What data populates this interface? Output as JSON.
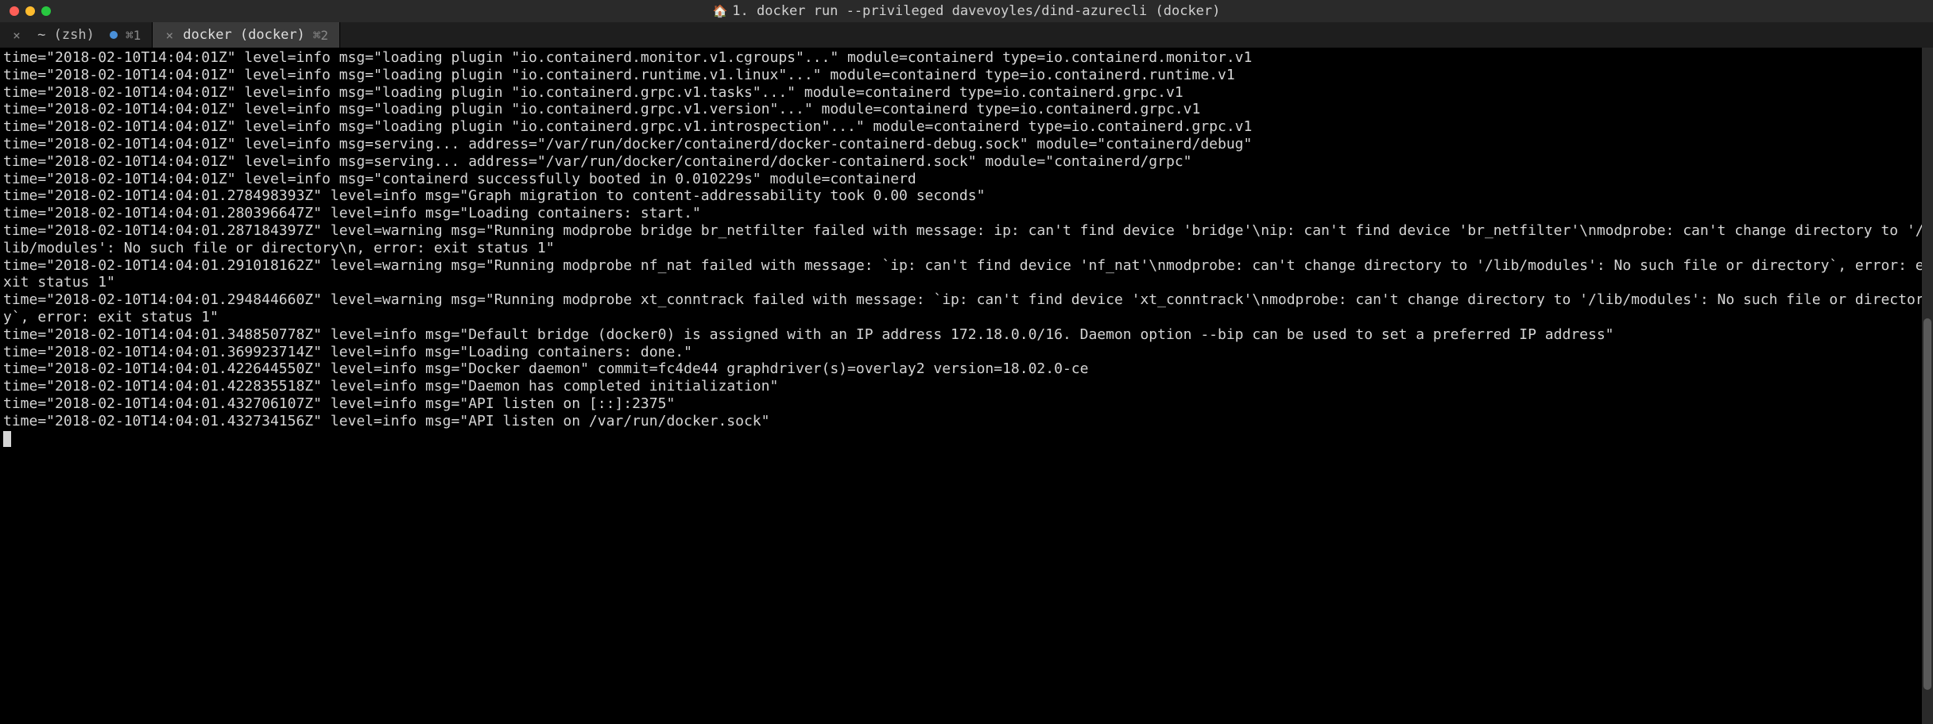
{
  "window": {
    "title": "1. docker run --privileged davevoyles/dind-azurecli (docker)",
    "home_icon": "🏠"
  },
  "tabs": [
    {
      "label": "~ (zsh)",
      "shortcut": "⌘1",
      "active": false,
      "has_dot": true
    },
    {
      "label": "docker (docker)",
      "shortcut": "⌘2",
      "active": true,
      "has_dot": false
    }
  ],
  "terminal_lines": [
    "time=\"2018-02-10T14:04:01Z\" level=info msg=\"loading plugin \"io.containerd.monitor.v1.cgroups\"...\" module=containerd type=io.containerd.monitor.v1",
    "time=\"2018-02-10T14:04:01Z\" level=info msg=\"loading plugin \"io.containerd.runtime.v1.linux\"...\" module=containerd type=io.containerd.runtime.v1",
    "time=\"2018-02-10T14:04:01Z\" level=info msg=\"loading plugin \"io.containerd.grpc.v1.tasks\"...\" module=containerd type=io.containerd.grpc.v1",
    "time=\"2018-02-10T14:04:01Z\" level=info msg=\"loading plugin \"io.containerd.grpc.v1.version\"...\" module=containerd type=io.containerd.grpc.v1",
    "time=\"2018-02-10T14:04:01Z\" level=info msg=\"loading plugin \"io.containerd.grpc.v1.introspection\"...\" module=containerd type=io.containerd.grpc.v1",
    "time=\"2018-02-10T14:04:01Z\" level=info msg=serving... address=\"/var/run/docker/containerd/docker-containerd-debug.sock\" module=\"containerd/debug\"",
    "time=\"2018-02-10T14:04:01Z\" level=info msg=serving... address=\"/var/run/docker/containerd/docker-containerd.sock\" module=\"containerd/grpc\"",
    "time=\"2018-02-10T14:04:01Z\" level=info msg=\"containerd successfully booted in 0.010229s\" module=containerd",
    "time=\"2018-02-10T14:04:01.278498393Z\" level=info msg=\"Graph migration to content-addressability took 0.00 seconds\"",
    "time=\"2018-02-10T14:04:01.280396647Z\" level=info msg=\"Loading containers: start.\"",
    "time=\"2018-02-10T14:04:01.287184397Z\" level=warning msg=\"Running modprobe bridge br_netfilter failed with message: ip: can't find device 'bridge'\\nip: can't find device 'br_netfilter'\\nmodprobe: can't change directory to '/lib/modules': No such file or directory\\n, error: exit status 1\"",
    "time=\"2018-02-10T14:04:01.291018162Z\" level=warning msg=\"Running modprobe nf_nat failed with message: `ip: can't find device 'nf_nat'\\nmodprobe: can't change directory to '/lib/modules': No such file or directory`, error: exit status 1\"",
    "time=\"2018-02-10T14:04:01.294844660Z\" level=warning msg=\"Running modprobe xt_conntrack failed with message: `ip: can't find device 'xt_conntrack'\\nmodprobe: can't change directory to '/lib/modules': No such file or directory`, error: exit status 1\"",
    "time=\"2018-02-10T14:04:01.348850778Z\" level=info msg=\"Default bridge (docker0) is assigned with an IP address 172.18.0.0/16. Daemon option --bip can be used to set a preferred IP address\"",
    "time=\"2018-02-10T14:04:01.369923714Z\" level=info msg=\"Loading containers: done.\"",
    "time=\"2018-02-10T14:04:01.422644550Z\" level=info msg=\"Docker daemon\" commit=fc4de44 graphdriver(s)=overlay2 version=18.02.0-ce",
    "time=\"2018-02-10T14:04:01.422835518Z\" level=info msg=\"Daemon has completed initialization\"",
    "time=\"2018-02-10T14:04:01.432706107Z\" level=info msg=\"API listen on [::]:2375\"",
    "time=\"2018-02-10T14:04:01.432734156Z\" level=info msg=\"API listen on /var/run/docker.sock\""
  ]
}
